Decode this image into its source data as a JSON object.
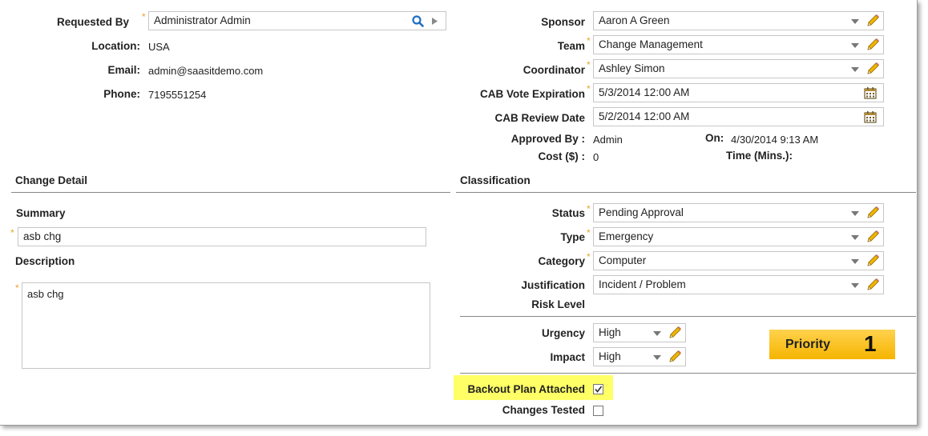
{
  "requester": {
    "requested_by_label": "Requested By",
    "requested_by_value": "Administrator Admin",
    "location_label": "Location:",
    "location_value": "USA",
    "email_label": "Email:",
    "email_value": "admin@saasitdemo.com",
    "phone_label": "Phone:",
    "phone_value": "7195551254"
  },
  "assignment": {
    "sponsor_label": "Sponsor",
    "sponsor_value": "Aaron A Green",
    "team_label": "Team",
    "team_value": "Change Management",
    "coordinator_label": "Coordinator",
    "coordinator_value": "Ashley Simon",
    "cab_vote_label": "CAB Vote Expiration",
    "cab_vote_value": "5/3/2014 12:00 AM",
    "cab_review_label": "CAB Review Date",
    "cab_review_value": "5/2/2014 12:00 AM",
    "approved_by_label": "Approved By :",
    "approved_by_value": "Admin",
    "on_label": "On:",
    "on_value": "4/30/2014 9:13 AM",
    "cost_label": "Cost ($) :",
    "cost_value": "0",
    "time_label": "Time (Mins.):"
  },
  "change_detail": {
    "title": "Change Detail",
    "summary_label": "Summary",
    "summary_value": "asb chg",
    "description_label": "Description",
    "description_value": "asb chg"
  },
  "classification": {
    "title": "Classification",
    "status_label": "Status",
    "status_value": "Pending Approval",
    "type_label": "Type",
    "type_value": "Emergency",
    "category_label": "Category",
    "category_value": "Computer",
    "justification_label": "Justification",
    "justification_value": "Incident / Problem",
    "risk_label": "Risk Level",
    "urgency_label": "Urgency",
    "urgency_value": "High",
    "impact_label": "Impact",
    "impact_value": "High",
    "priority_label": "Priority",
    "priority_value": "1",
    "backout_label": "Backout Plan Attached",
    "backout_checked": true,
    "tested_label": "Changes Tested",
    "tested_checked": false
  },
  "colors": {
    "required_star": "#f0a030",
    "highlight": "#ffff66",
    "priority_bg": "#f5b400",
    "search_icon": "#1f6fc5",
    "pencil": "#e8a800"
  },
  "icons": [
    "search-icon",
    "play-arrow-icon",
    "dropdown-arrow-icon",
    "pencil-icon",
    "calendar-icon",
    "checkbox-icon"
  ]
}
